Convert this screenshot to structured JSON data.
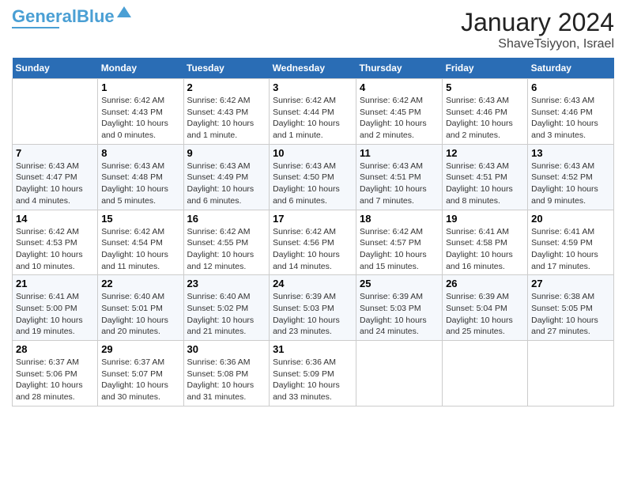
{
  "logo": {
    "part1": "General",
    "part2": "Blue"
  },
  "title": "January 2024",
  "subtitle": "ShaveTsiyyon, Israel",
  "days_header": [
    "Sunday",
    "Monday",
    "Tuesday",
    "Wednesday",
    "Thursday",
    "Friday",
    "Saturday"
  ],
  "weeks": [
    [
      {
        "num": "",
        "sunrise": "",
        "sunset": "",
        "daylight": ""
      },
      {
        "num": "1",
        "sunrise": "Sunrise: 6:42 AM",
        "sunset": "Sunset: 4:43 PM",
        "daylight": "Daylight: 10 hours and 0 minutes."
      },
      {
        "num": "2",
        "sunrise": "Sunrise: 6:42 AM",
        "sunset": "Sunset: 4:43 PM",
        "daylight": "Daylight: 10 hours and 1 minute."
      },
      {
        "num": "3",
        "sunrise": "Sunrise: 6:42 AM",
        "sunset": "Sunset: 4:44 PM",
        "daylight": "Daylight: 10 hours and 1 minute."
      },
      {
        "num": "4",
        "sunrise": "Sunrise: 6:42 AM",
        "sunset": "Sunset: 4:45 PM",
        "daylight": "Daylight: 10 hours and 2 minutes."
      },
      {
        "num": "5",
        "sunrise": "Sunrise: 6:43 AM",
        "sunset": "Sunset: 4:46 PM",
        "daylight": "Daylight: 10 hours and 2 minutes."
      },
      {
        "num": "6",
        "sunrise": "Sunrise: 6:43 AM",
        "sunset": "Sunset: 4:46 PM",
        "daylight": "Daylight: 10 hours and 3 minutes."
      }
    ],
    [
      {
        "num": "7",
        "sunrise": "Sunrise: 6:43 AM",
        "sunset": "Sunset: 4:47 PM",
        "daylight": "Daylight: 10 hours and 4 minutes."
      },
      {
        "num": "8",
        "sunrise": "Sunrise: 6:43 AM",
        "sunset": "Sunset: 4:48 PM",
        "daylight": "Daylight: 10 hours and 5 minutes."
      },
      {
        "num": "9",
        "sunrise": "Sunrise: 6:43 AM",
        "sunset": "Sunset: 4:49 PM",
        "daylight": "Daylight: 10 hours and 6 minutes."
      },
      {
        "num": "10",
        "sunrise": "Sunrise: 6:43 AM",
        "sunset": "Sunset: 4:50 PM",
        "daylight": "Daylight: 10 hours and 6 minutes."
      },
      {
        "num": "11",
        "sunrise": "Sunrise: 6:43 AM",
        "sunset": "Sunset: 4:51 PM",
        "daylight": "Daylight: 10 hours and 7 minutes."
      },
      {
        "num": "12",
        "sunrise": "Sunrise: 6:43 AM",
        "sunset": "Sunset: 4:51 PM",
        "daylight": "Daylight: 10 hours and 8 minutes."
      },
      {
        "num": "13",
        "sunrise": "Sunrise: 6:43 AM",
        "sunset": "Sunset: 4:52 PM",
        "daylight": "Daylight: 10 hours and 9 minutes."
      }
    ],
    [
      {
        "num": "14",
        "sunrise": "Sunrise: 6:42 AM",
        "sunset": "Sunset: 4:53 PM",
        "daylight": "Daylight: 10 hours and 10 minutes."
      },
      {
        "num": "15",
        "sunrise": "Sunrise: 6:42 AM",
        "sunset": "Sunset: 4:54 PM",
        "daylight": "Daylight: 10 hours and 11 minutes."
      },
      {
        "num": "16",
        "sunrise": "Sunrise: 6:42 AM",
        "sunset": "Sunset: 4:55 PM",
        "daylight": "Daylight: 10 hours and 12 minutes."
      },
      {
        "num": "17",
        "sunrise": "Sunrise: 6:42 AM",
        "sunset": "Sunset: 4:56 PM",
        "daylight": "Daylight: 10 hours and 14 minutes."
      },
      {
        "num": "18",
        "sunrise": "Sunrise: 6:42 AM",
        "sunset": "Sunset: 4:57 PM",
        "daylight": "Daylight: 10 hours and 15 minutes."
      },
      {
        "num": "19",
        "sunrise": "Sunrise: 6:41 AM",
        "sunset": "Sunset: 4:58 PM",
        "daylight": "Daylight: 10 hours and 16 minutes."
      },
      {
        "num": "20",
        "sunrise": "Sunrise: 6:41 AM",
        "sunset": "Sunset: 4:59 PM",
        "daylight": "Daylight: 10 hours and 17 minutes."
      }
    ],
    [
      {
        "num": "21",
        "sunrise": "Sunrise: 6:41 AM",
        "sunset": "Sunset: 5:00 PM",
        "daylight": "Daylight: 10 hours and 19 minutes."
      },
      {
        "num": "22",
        "sunrise": "Sunrise: 6:40 AM",
        "sunset": "Sunset: 5:01 PM",
        "daylight": "Daylight: 10 hours and 20 minutes."
      },
      {
        "num": "23",
        "sunrise": "Sunrise: 6:40 AM",
        "sunset": "Sunset: 5:02 PM",
        "daylight": "Daylight: 10 hours and 21 minutes."
      },
      {
        "num": "24",
        "sunrise": "Sunrise: 6:39 AM",
        "sunset": "Sunset: 5:03 PM",
        "daylight": "Daylight: 10 hours and 23 minutes."
      },
      {
        "num": "25",
        "sunrise": "Sunrise: 6:39 AM",
        "sunset": "Sunset: 5:03 PM",
        "daylight": "Daylight: 10 hours and 24 minutes."
      },
      {
        "num": "26",
        "sunrise": "Sunrise: 6:39 AM",
        "sunset": "Sunset: 5:04 PM",
        "daylight": "Daylight: 10 hours and 25 minutes."
      },
      {
        "num": "27",
        "sunrise": "Sunrise: 6:38 AM",
        "sunset": "Sunset: 5:05 PM",
        "daylight": "Daylight: 10 hours and 27 minutes."
      }
    ],
    [
      {
        "num": "28",
        "sunrise": "Sunrise: 6:37 AM",
        "sunset": "Sunset: 5:06 PM",
        "daylight": "Daylight: 10 hours and 28 minutes."
      },
      {
        "num": "29",
        "sunrise": "Sunrise: 6:37 AM",
        "sunset": "Sunset: 5:07 PM",
        "daylight": "Daylight: 10 hours and 30 minutes."
      },
      {
        "num": "30",
        "sunrise": "Sunrise: 6:36 AM",
        "sunset": "Sunset: 5:08 PM",
        "daylight": "Daylight: 10 hours and 31 minutes."
      },
      {
        "num": "31",
        "sunrise": "Sunrise: 6:36 AM",
        "sunset": "Sunset: 5:09 PM",
        "daylight": "Daylight: 10 hours and 33 minutes."
      },
      {
        "num": "",
        "sunrise": "",
        "sunset": "",
        "daylight": ""
      },
      {
        "num": "",
        "sunrise": "",
        "sunset": "",
        "daylight": ""
      },
      {
        "num": "",
        "sunrise": "",
        "sunset": "",
        "daylight": ""
      }
    ]
  ]
}
